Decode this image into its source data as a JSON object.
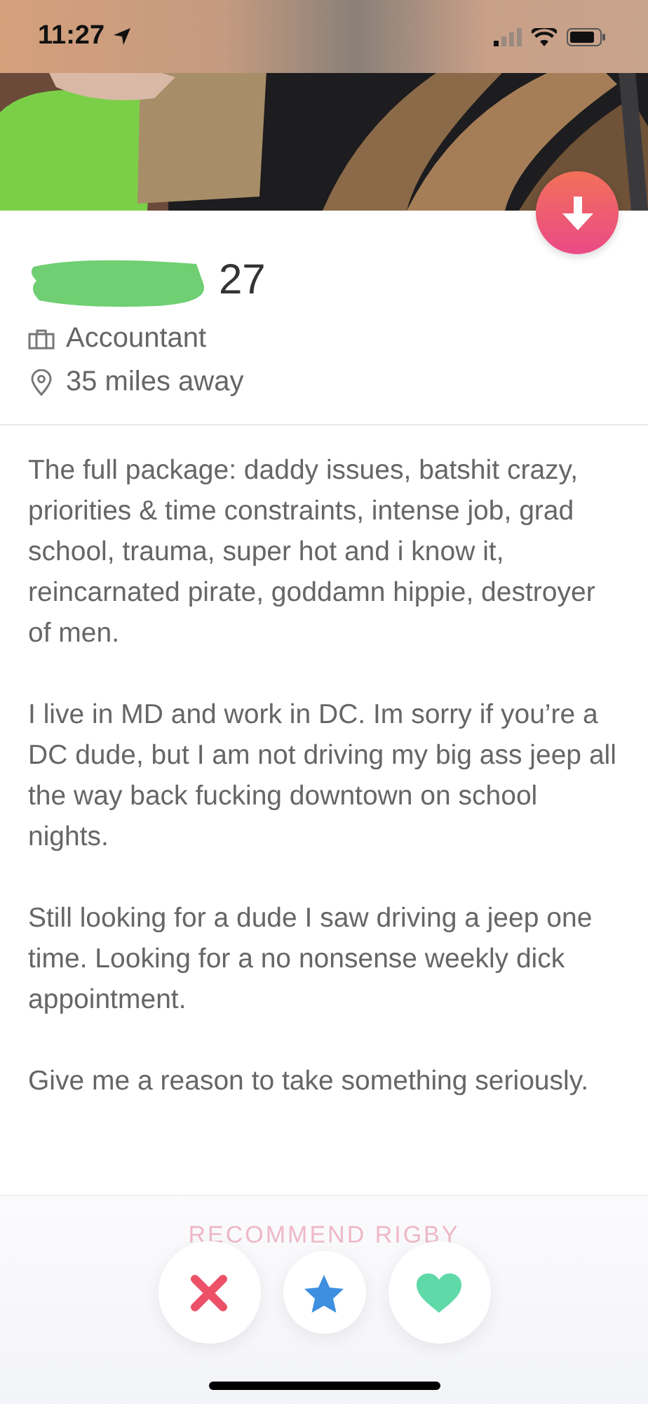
{
  "status_bar": {
    "time": "11:27"
  },
  "profile": {
    "age": "27",
    "job": "Accountant",
    "distance": "35 miles away"
  },
  "bio": [
    "The full package: daddy issues, batshit crazy, priorities & time constraints, intense job, grad school, trauma, super hot and i know it, reincarnated pirate, goddamn hippie, destroyer of men.",
    "I live in MD and work in DC. Im sorry if you’re a DC dude, but I am not driving my big ass jeep all the way back fucking downtown on school nights.",
    "Still looking for a dude I saw driving a jeep one time. Looking for a no nonsense weekly dick appointment.",
    "Give me a reason to take something seriously."
  ],
  "recommend": "RECOMMEND RIGBY",
  "actions": [
    {
      "kind": "nope"
    },
    {
      "kind": "super"
    },
    {
      "kind": "like"
    }
  ]
}
